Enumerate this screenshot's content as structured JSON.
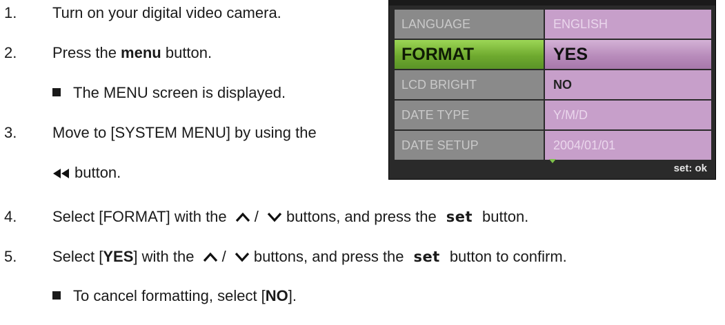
{
  "steps": [
    {
      "num": "1.",
      "text": "Turn on your digital video camera."
    },
    {
      "num": "2.",
      "pre": "Press the ",
      "bold": "menu",
      "post": " button."
    },
    {
      "sub": "The MENU screen is displayed."
    },
    {
      "num": "3.",
      "text": "Move to [SYSTEM MENU] by using the",
      "line2": "button."
    },
    {
      "num": "4.",
      "pre": "Select [FORMAT] with the",
      "sep": "/",
      "mid": "buttons, and press the",
      "set": "set",
      "post": "button."
    },
    {
      "num": "5.",
      "pre": "Select [",
      "bold": "YES",
      "mid_pre": "] with the",
      "sep": "/",
      "mid": "buttons, and press the",
      "set": "set",
      "post": "button to confirm."
    },
    {
      "sub_pre": "To cancel formatting, select [",
      "sub_bold": "NO",
      "sub_post": "]."
    }
  ],
  "lcd_menu": {
    "rows": [
      {
        "label": "LANGUAGE",
        "value": "ENGLISH"
      },
      {
        "label": "FORMAT",
        "value": "YES"
      },
      {
        "label": "LCD BRIGHT",
        "value": "NO"
      },
      {
        "label": "DATE TYPE",
        "value": "Y/M/D"
      },
      {
        "label": "DATE SETUP",
        "value": "2004/01/01"
      }
    ],
    "selected_row": "FORMAT",
    "footer_hint": "set: ok"
  },
  "icons": {
    "rewind": "rewind-button-icon",
    "up": "up-arrow-icon",
    "down": "down-arrow-icon",
    "scroll": "scroll-down-icon"
  }
}
